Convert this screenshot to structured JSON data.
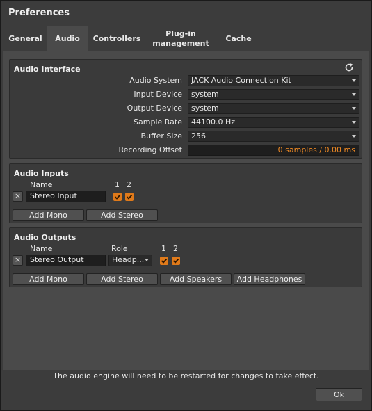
{
  "window": {
    "title": "Preferences"
  },
  "tabs": [
    {
      "label": "General"
    },
    {
      "label": "Audio",
      "active": true
    },
    {
      "label": "Controllers"
    },
    {
      "label_line1": "Plug-in",
      "label_line2": "management"
    },
    {
      "label": "Cache"
    }
  ],
  "audio_interface": {
    "title": "Audio Interface",
    "refresh_icon": "refresh-icon",
    "audio_system": {
      "label": "Audio System",
      "value": "JACK Audio Connection Kit"
    },
    "input_device": {
      "label": "Input Device",
      "value": "system"
    },
    "output_device": {
      "label": "Output Device",
      "value": "system"
    },
    "sample_rate": {
      "label": "Sample Rate",
      "value": "44100.0 Hz"
    },
    "buffer_size": {
      "label": "Buffer Size",
      "value": "256"
    },
    "recording_offset": {
      "label": "Recording Offset",
      "value": "0 samples / 0.00 ms"
    }
  },
  "audio_inputs": {
    "title": "Audio Inputs",
    "col_name": "Name",
    "col_1": "1",
    "col_2": "2",
    "row": {
      "remove": "×",
      "name": "Stereo Input",
      "ch1": true,
      "ch2": true
    },
    "add_mono": "Add Mono",
    "add_stereo": "Add Stereo"
  },
  "audio_outputs": {
    "title": "Audio Outputs",
    "col_name": "Name",
    "col_role": "Role",
    "col_1": "1",
    "col_2": "2",
    "row": {
      "remove": "×",
      "name": "Stereo Output",
      "role": "Headp...",
      "ch1": true,
      "ch2": true
    },
    "add_mono": "Add Mono",
    "add_stereo": "Add Stereo",
    "add_speakers": "Add Speakers",
    "add_headphones": "Add Headphones"
  },
  "footer": {
    "status": "The audio engine will need to be restarted for changes to take effect.",
    "ok": "Ok"
  },
  "colors": {
    "accent": "#e07a1a",
    "offset_text": "#f08a24"
  }
}
